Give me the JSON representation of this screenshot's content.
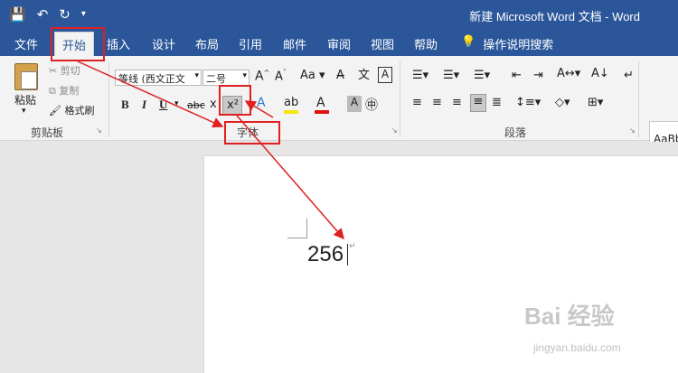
{
  "titlebar": {
    "save_icon": "save-icon",
    "undo_icon": "undo-icon",
    "redo_icon": "redo-icon",
    "customize_icon": "customize-qat-icon",
    "title": "新建 Microsoft Word 文档 - Word"
  },
  "tabs": {
    "file": "文件",
    "home": "开始",
    "insert": "插入",
    "design": "设计",
    "layout": "布局",
    "references": "引用",
    "mailings": "邮件",
    "review": "审阅",
    "view": "视图",
    "help": "帮助",
    "tell_me": "操作说明搜索"
  },
  "clipboard": {
    "paste": "粘贴",
    "cut": "剪切",
    "copy": "复制",
    "format_painter": "格式刷",
    "group_label": "剪贴板"
  },
  "font": {
    "font_name": "等线 (西文正文",
    "font_size": "二号",
    "bold": "B",
    "italic": "I",
    "underline": "U",
    "strikethrough": "abc",
    "subscript": "x",
    "superscript": "x²",
    "change_case": "Aa",
    "group_label": "字体"
  },
  "paragraph": {
    "group_label": "段落"
  },
  "styles": {
    "preview": "AaBb"
  },
  "document": {
    "text": "256"
  },
  "watermark": {
    "text": "Bai 经验",
    "url": "jingyan.baidu.com"
  },
  "colors": {
    "ribbon_blue": "#2b579a",
    "annotation_red": "#e02020"
  }
}
